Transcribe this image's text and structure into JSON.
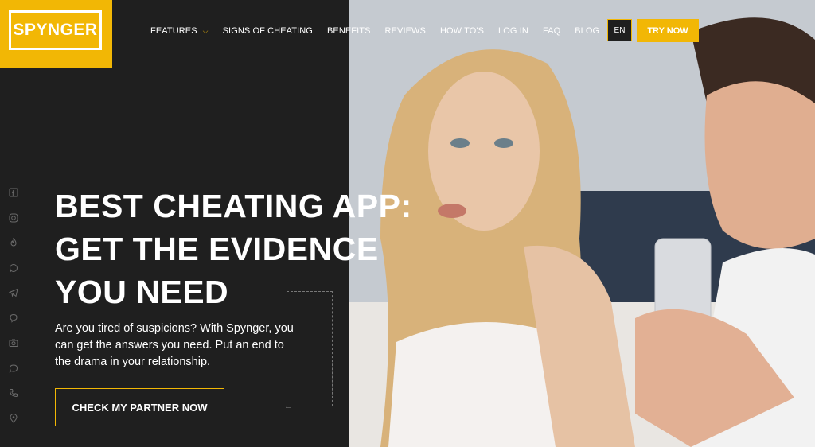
{
  "logo": {
    "text": "SPYNGER"
  },
  "nav": {
    "items": [
      {
        "label": "FEATURES",
        "has_dropdown": true
      },
      {
        "label": "SIGNS OF CHEATING"
      },
      {
        "label": "BENEFITS"
      },
      {
        "label": "REVIEWS"
      },
      {
        "label": "HOW TO'S"
      },
      {
        "label": "LOG IN"
      },
      {
        "label": "FAQ"
      },
      {
        "label": "BLOG"
      }
    ],
    "lang": "EN",
    "try_label": "TRY NOW"
  },
  "hero": {
    "headline_lines": [
      "BEST CHEATING APP:",
      "GET THE EVIDENCE",
      "YOU NEED"
    ],
    "subtext": "Are you tired of suspicions? With Spynger, you can get the answers you need. Put an end to the drama in your relationship.",
    "cta_label": "CHECK MY PARTNER NOW"
  },
  "social_icons": [
    "facebook-icon",
    "instagram-icon",
    "tinder-icon",
    "whatsapp-icon",
    "telegram-icon",
    "viber-icon",
    "camera-icon",
    "chat-icon",
    "phone-icon",
    "location-icon"
  ],
  "colors": {
    "accent": "#f2b705",
    "panel": "#1f1f1f",
    "text": "#ffffff"
  }
}
